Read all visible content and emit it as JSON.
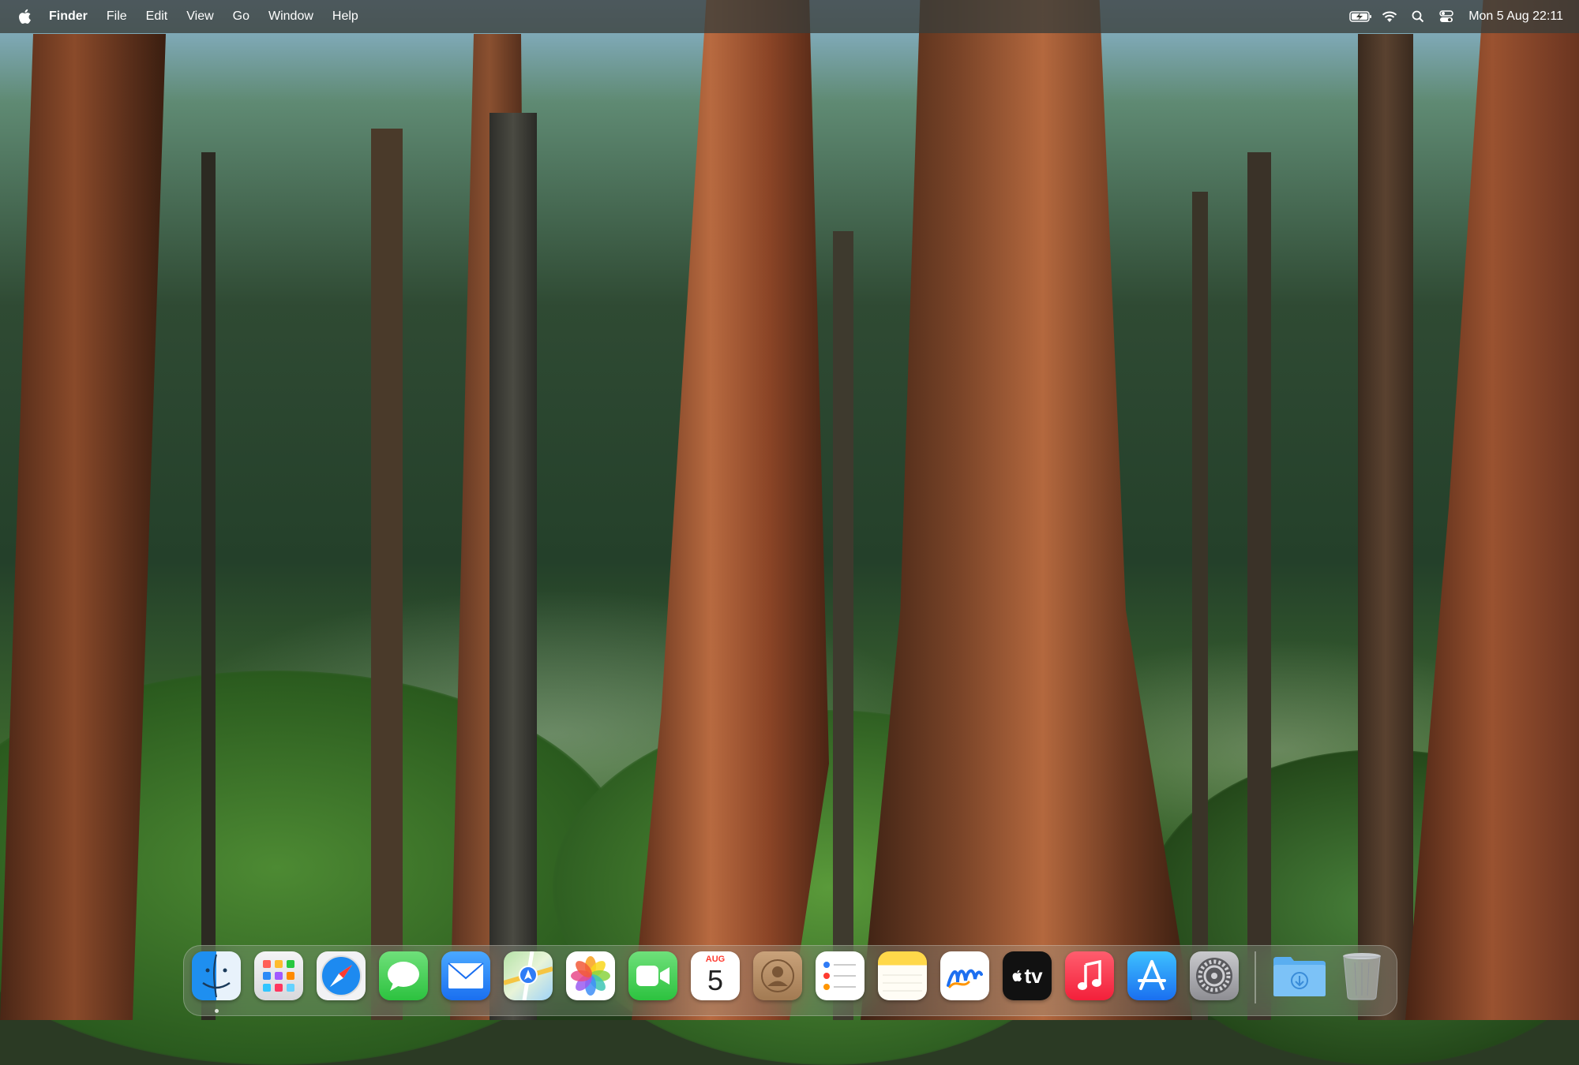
{
  "menubar": {
    "app_name": "Finder",
    "menus": [
      "File",
      "Edit",
      "View",
      "Go",
      "Window",
      "Help"
    ],
    "clock": "Mon 5 Aug  22:11"
  },
  "status_icons": [
    "battery-charging-icon",
    "wifi-icon",
    "spotlight-search-icon",
    "control-center-icon"
  ],
  "dock": {
    "apps": [
      {
        "name": "Finder",
        "icon": "finder-icon",
        "running": true
      },
      {
        "name": "Launchpad",
        "icon": "launchpad-icon"
      },
      {
        "name": "Safari",
        "icon": "safari-icon"
      },
      {
        "name": "Messages",
        "icon": "messages-icon"
      },
      {
        "name": "Mail",
        "icon": "mail-icon"
      },
      {
        "name": "Maps",
        "icon": "maps-icon"
      },
      {
        "name": "Photos",
        "icon": "photos-icon"
      },
      {
        "name": "FaceTime",
        "icon": "facetime-icon"
      },
      {
        "name": "Calendar",
        "icon": "calendar-icon"
      },
      {
        "name": "Contacts",
        "icon": "contacts-icon"
      },
      {
        "name": "Reminders",
        "icon": "reminders-icon"
      },
      {
        "name": "Notes",
        "icon": "notes-icon"
      },
      {
        "name": "Freeform",
        "icon": "freeform-icon"
      },
      {
        "name": "TV",
        "icon": "apple-tv-icon"
      },
      {
        "name": "Music",
        "icon": "music-icon"
      },
      {
        "name": "App Store",
        "icon": "app-store-icon"
      },
      {
        "name": "System Settings",
        "icon": "system-settings-icon"
      }
    ],
    "calendar": {
      "month": "AUG",
      "day": "5"
    },
    "tv_label": "tv",
    "stacks": [
      {
        "name": "Downloads",
        "icon": "downloads-folder-icon"
      },
      {
        "name": "Bin",
        "icon": "trash-icon"
      }
    ]
  },
  "colors": {
    "menubar_bg": "#3a3e3a",
    "dock_bg": "#aab4aa",
    "calendar_red": "#ff3b30"
  }
}
